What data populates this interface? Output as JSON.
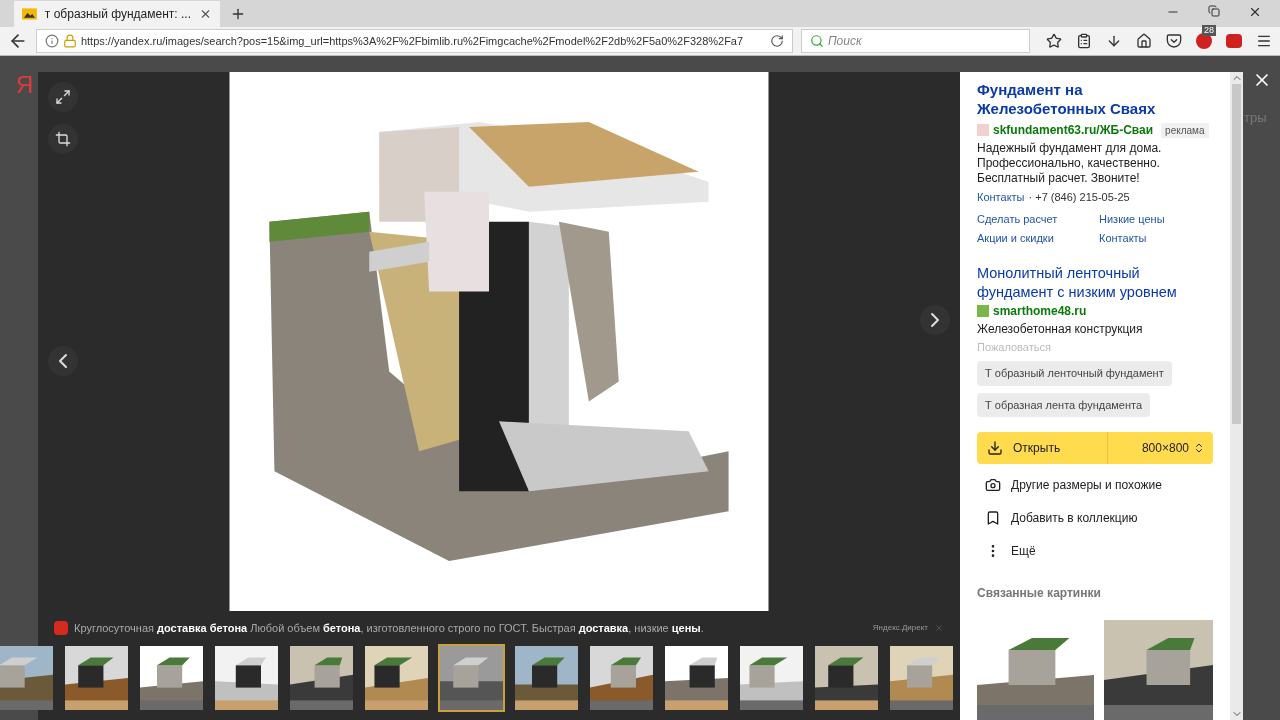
{
  "browser": {
    "tab_title": "т образный фундамент: ...",
    "url": "https://yandex.ru/images/search?pos=15&img_url=https%3A%2F%2Fbimlib.ru%2Fimgcache%2Fmodel%2F2db%2F5a0%2F328%2Fa7",
    "search_placeholder": "Поиск",
    "extension_badge": "28"
  },
  "background_page": {
    "logo": "Я",
    "filters_label": "тры"
  },
  "viewer": {
    "ad": {
      "text": "Круглосуточная **доставка бетона** Любой объем **бетона**, изготовленного строго по ГОСТ. Быстрая **доставка**, низкие **цены**.",
      "source": "Яндекс.Директ"
    },
    "thumbnails": [
      {
        "selected": false
      },
      {
        "selected": false
      },
      {
        "selected": false
      },
      {
        "selected": false
      },
      {
        "selected": false
      },
      {
        "selected": false
      },
      {
        "selected": true
      },
      {
        "selected": false
      },
      {
        "selected": false
      },
      {
        "selected": false
      },
      {
        "selected": false
      },
      {
        "selected": false
      },
      {
        "selected": false
      }
    ]
  },
  "panel": {
    "ads": [
      {
        "title": "Фундамент на Железобетонных Сваях",
        "domain": "skfundament63.ru/ЖБ-Сваи",
        "label": "реклама",
        "description": "Надежный фундамент для дома. Профессионально, качественно. Бесплатный расчет. Звоните!",
        "contacts": "Контакты",
        "phone": "· +7 (846) 215-05-25",
        "links": [
          "Сделать расчет",
          "Низкие цены",
          "Акции и скидки",
          "Контакты"
        ]
      },
      {
        "title": "Монолитный ленточный фундамент с низким уровнем",
        "domain": "smarthome48.ru",
        "description": "Железобетонная конструкция",
        "complaint": "Пожаловаться"
      }
    ],
    "tags": [
      "Т образный ленточный фундамент",
      "Т образная лента фундамента"
    ],
    "open_button": "Открыть",
    "size": "800×800",
    "actions": [
      {
        "kind": "camera",
        "label": "Другие размеры и похожие"
      },
      {
        "kind": "bookmark",
        "label": "Добавить в коллекцию"
      },
      {
        "kind": "more",
        "label": "Ещё"
      }
    ],
    "related_title": "Связанные картинки"
  }
}
